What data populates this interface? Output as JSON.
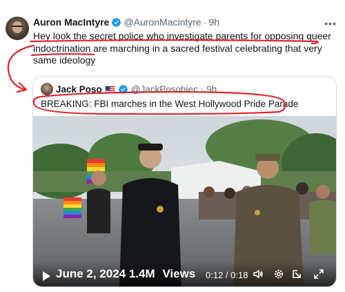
{
  "tweet": {
    "author_name": "Auron MacIntyre",
    "author_handle": "@AuronMacintyre",
    "dot": "·",
    "time": "9h",
    "more_icon": "more-icon",
    "text": "Hey look the secret police who investigate parents for opposing queer indoctrination are marching in a sacred festival celebrating that very same ideology"
  },
  "quote": {
    "author_name": "Jack Poso",
    "author_handle": "@JackPosobiec",
    "dot": "·",
    "time": "9h",
    "flag_icon": "us-flag-icon",
    "text": "BREAKING: FBI marches in the West Hollywood Pride Parade"
  },
  "video": {
    "date_views": "June 2, 2024 1.4M",
    "views_label": "Views",
    "time": "0:12 / 0:18",
    "icons": [
      "play-icon",
      "volume-icon",
      "settings-icon",
      "popout-icon",
      "fullscreen-icon"
    ]
  },
  "colors": {
    "verified": "#1d9bf0",
    "annotation_red": "#e0242c",
    "muted_text": "#536471"
  }
}
